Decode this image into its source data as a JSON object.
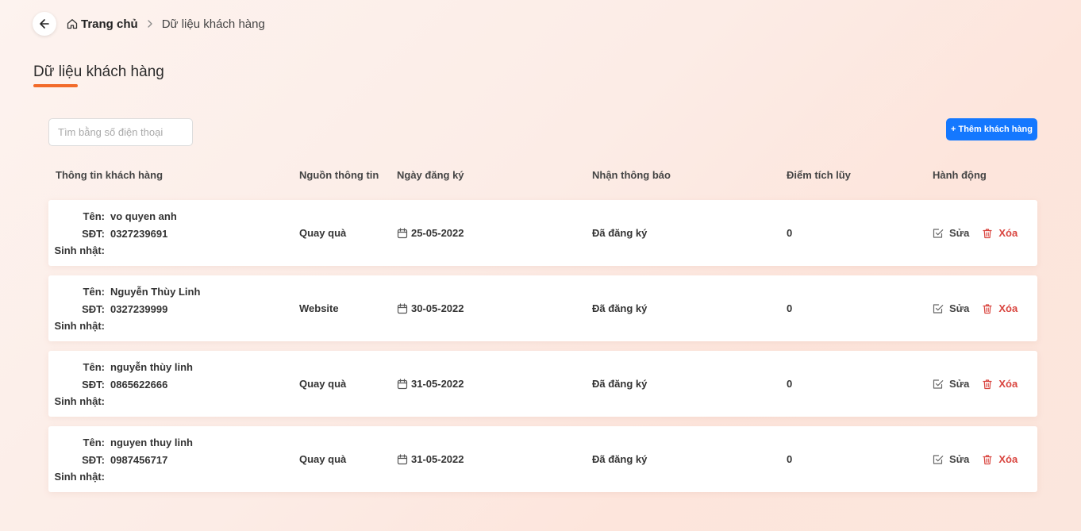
{
  "breadcrumb": {
    "home_label": "Trang chủ",
    "current_label": "Dữ liệu khách hàng"
  },
  "page": {
    "title": "Dữ liệu khách hàng",
    "accent_color": "#f26b2a"
  },
  "search": {
    "placeholder": "Tìm bằng số điện thoại",
    "value": ""
  },
  "add_button": {
    "label": "+ Thêm khách hàng",
    "color": "#1478ff"
  },
  "table": {
    "columns": [
      "Thông tin khách hàng",
      "Nguồn thông tin",
      "Ngày đăng ký",
      "Nhận thông báo",
      "Điểm tích lũy",
      "Hành động"
    ],
    "labels": {
      "name": "Tên:",
      "phone": "SĐT:",
      "birthday": "Sinh nhật:"
    },
    "actions": {
      "edit": "Sửa",
      "delete": "Xóa"
    },
    "rows": [
      {
        "name": "vo quyen anh",
        "phone": "0327239691",
        "birthday": "",
        "source": "Quay quà",
        "date": "25-05-2022",
        "notify": "Đã đăng ký",
        "points": "0"
      },
      {
        "name": "Nguyễn Thùy Linh",
        "phone": "0327239999",
        "birthday": "",
        "source": "Website",
        "date": "30-05-2022",
        "notify": "Đã đăng ký",
        "points": "0"
      },
      {
        "name": "nguyễn thùy linh",
        "phone": "0865622666",
        "birthday": "",
        "source": "Quay quà",
        "date": "31-05-2022",
        "notify": "Đã đăng ký",
        "points": "0"
      },
      {
        "name": "nguyen thuy linh",
        "phone": "0987456717",
        "birthday": "",
        "source": "Quay quà",
        "date": "31-05-2022",
        "notify": "Đã đăng ký",
        "points": "0"
      }
    ]
  }
}
